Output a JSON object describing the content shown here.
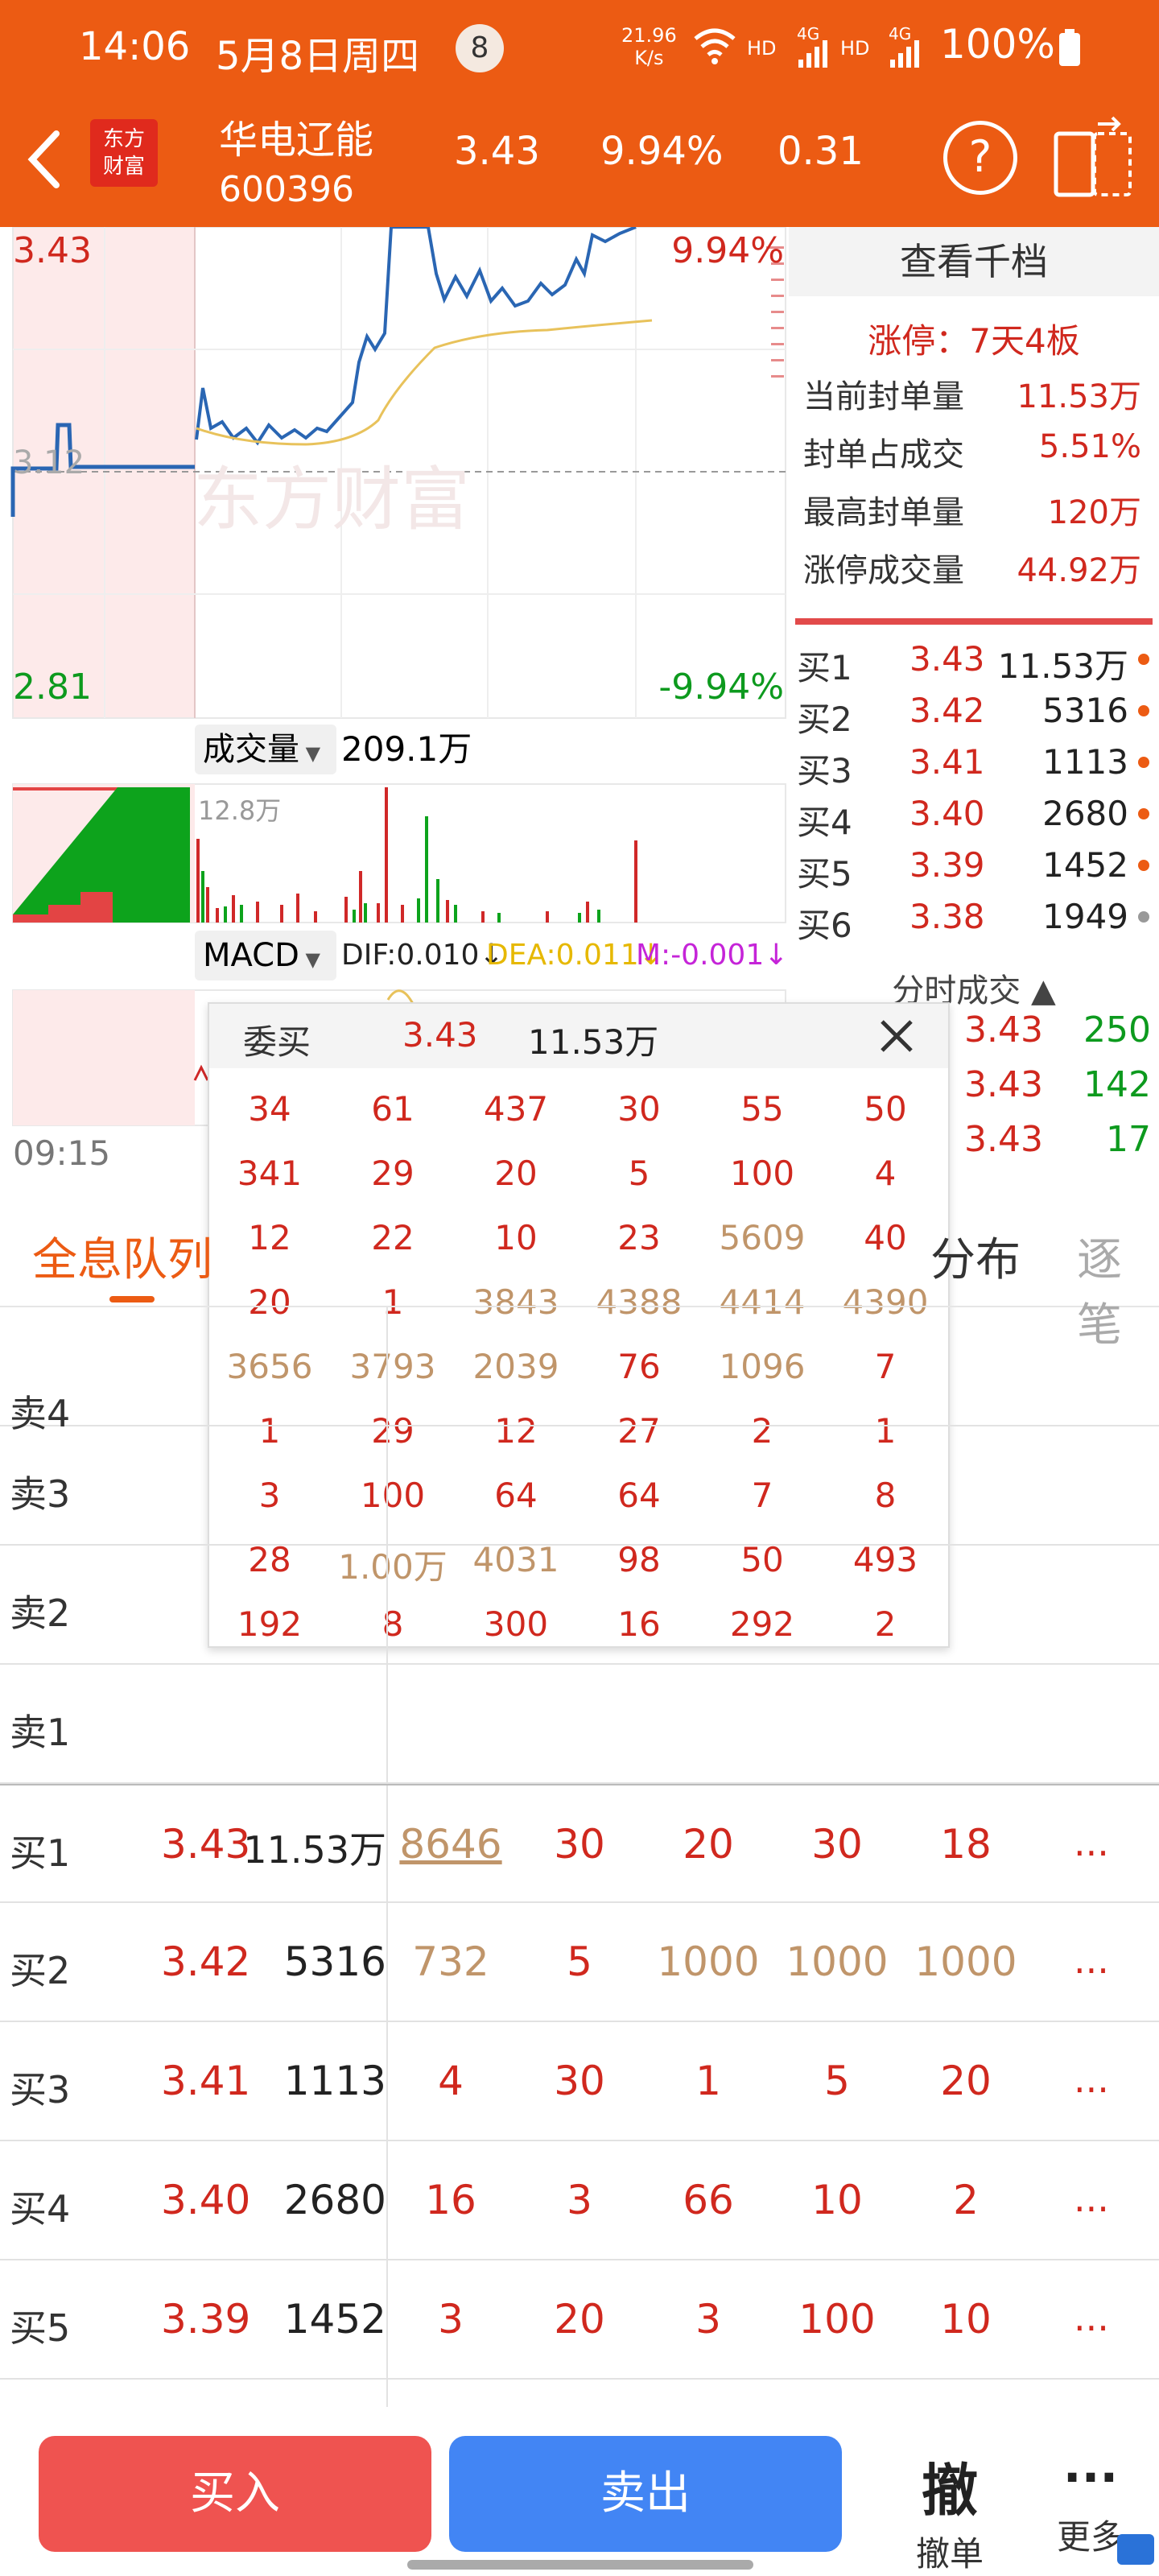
{
  "status_bar": {
    "time": "14:06",
    "date": "5月8日周四",
    "badge": "8",
    "net_speed": "21.96",
    "net_unit": "K/s",
    "hd1": "HD",
    "hd2": "HD",
    "g1": "4G",
    "g2": "4G",
    "battery": "100%"
  },
  "header": {
    "back_icon": "chevron-left-icon",
    "logo_text1": "东方",
    "logo_text2": "财富",
    "stock_name": "华电辽能",
    "stock_code": "600396",
    "price": "3.43",
    "change_pct": "9.94%",
    "change": "0.31",
    "help_label": "?"
  },
  "chart": {
    "price_high": "3.43",
    "price_low": "2.81",
    "pct_high": "9.94%",
    "pct_low": "-9.94%",
    "mid_price": "3.12",
    "watermark": "东方财富",
    "time_start": "09:15",
    "volume_label": "成交量",
    "volume_value": "209.1万",
    "volume_axis": "12.8万",
    "macd_label": "MACD",
    "dif": "DIF:0.010",
    "dea": "DEA:0.011",
    "m": "M:-0.001"
  },
  "right_panel": {
    "title": "查看千档",
    "limit_up": "涨停：7天4板",
    "stats": [
      {
        "label": "当前封单量",
        "value": "11.53万"
      },
      {
        "label": "封单占成交",
        "value": "5.51%"
      },
      {
        "label": "最高封单量",
        "value": "120万"
      },
      {
        "label": "涨停成交量",
        "value": "44.92万"
      }
    ],
    "book": [
      {
        "label": "买1",
        "price": "3.43",
        "vol": "11.53万"
      },
      {
        "label": "买2",
        "price": "3.42",
        "vol": "5316"
      },
      {
        "label": "买3",
        "price": "3.41",
        "vol": "1113"
      },
      {
        "label": "买4",
        "price": "3.40",
        "vol": "2680"
      },
      {
        "label": "买5",
        "price": "3.39",
        "vol": "1452"
      },
      {
        "label": "买6",
        "price": "3.38",
        "vol": "1949"
      }
    ],
    "ticks_title": "分时成交",
    "ticks": [
      {
        "price": "3.43",
        "vol": "250"
      },
      {
        "price": "3.43",
        "vol": "142"
      },
      {
        "price": "3.43",
        "vol": "17"
      }
    ]
  },
  "popup": {
    "title": "委买",
    "price": "3.43",
    "vol": "11.53万",
    "rows": [
      [
        "34",
        "61",
        "437",
        "30",
        "55",
        "50"
      ],
      [
        "341",
        "29",
        "20",
        "5",
        "100",
        "4"
      ],
      [
        "12",
        "22",
        "10",
        "23",
        "5609",
        "40"
      ],
      [
        "20",
        "1",
        "3843",
        "4388",
        "4414",
        "4390"
      ],
      [
        "3656",
        "3793",
        "2039",
        "76",
        "1096",
        "7"
      ],
      [
        "1",
        "29",
        "12",
        "27",
        "2",
        "1"
      ],
      [
        "3",
        "100",
        "64",
        "64",
        "7",
        "8"
      ],
      [
        "28",
        "1.00万",
        "4031",
        "98",
        "50",
        "493"
      ],
      [
        "192",
        "8",
        "300",
        "16",
        "292",
        "2"
      ]
    ]
  },
  "tabs": {
    "t1": "全息队列",
    "t2": "分布",
    "t3": "逐笔"
  },
  "queue": {
    "sells": [
      "卖4",
      "卖3",
      "卖2",
      "卖1"
    ],
    "buys": [
      {
        "label": "买1",
        "price": "3.43",
        "vol": "11.53万",
        "cells": [
          "8646",
          "30",
          "20",
          "30",
          "18"
        ],
        "more": "..."
      },
      {
        "label": "买2",
        "price": "3.42",
        "vol": "5316",
        "cells": [
          "732",
          "5",
          "1000",
          "1000",
          "1000"
        ],
        "more": "..."
      },
      {
        "label": "买3",
        "price": "3.41",
        "vol": "1113",
        "cells": [
          "4",
          "30",
          "1",
          "5",
          "20"
        ],
        "more": "..."
      },
      {
        "label": "买4",
        "price": "3.40",
        "vol": "2680",
        "cells": [
          "16",
          "3",
          "66",
          "10",
          "2"
        ],
        "more": "..."
      },
      {
        "label": "买5",
        "price": "3.39",
        "vol": "1452",
        "cells": [
          "3",
          "20",
          "3",
          "100",
          "10"
        ],
        "more": "..."
      }
    ]
  },
  "bottom": {
    "buy": "买入",
    "sell": "卖出",
    "cancel_icon": "撤",
    "cancel": "撤单",
    "more_icon": "···",
    "more": "更多"
  },
  "colors": {
    "brand": "#ec5b13",
    "up": "#d0281e",
    "down": "#0d9a1e",
    "gold": "#c0956a",
    "buy_btn": "#ef5350",
    "sell_btn": "#4285f4"
  }
}
